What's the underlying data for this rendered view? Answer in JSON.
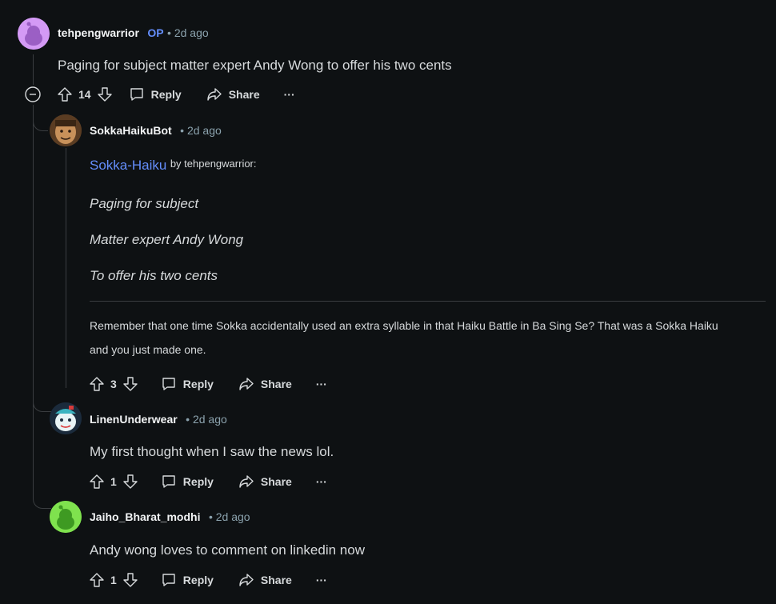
{
  "comments": [
    {
      "username": "tehpengwarrior",
      "op_badge": "OP",
      "time": "• 2d ago",
      "text": "Paging for subject matter expert Andy Wong to offer his two cents",
      "votes": "14",
      "reply": "Reply",
      "share": "Share",
      "more": "···"
    },
    {
      "username": "SokkaHaikuBot",
      "time": "• 2d ago",
      "haiku_link": "Sokka-Haiku",
      "haiku_by": "by tehpengwarrior:",
      "lines": [
        "Paging for subject",
        "Matter expert Andy Wong",
        "To offer his two cents"
      ],
      "footer_line1": "Remember that one time Sokka accidentally used an extra syllable in that Haiku Battle in Ba Sing Se? That was a Sokka Haiku",
      "footer_line2": "and you just made one.",
      "votes": "3",
      "reply": "Reply",
      "share": "Share",
      "more": "···"
    },
    {
      "username": "LinenUnderwear",
      "time": "• 2d ago",
      "text": "My first thought when I saw the news lol.",
      "votes": "1",
      "reply": "Reply",
      "share": "Share",
      "more": "···"
    },
    {
      "username": "Jaiho_Bharat_modhi",
      "time": "• 2d ago",
      "text": "Andy wong loves to comment on linkedin now",
      "votes": "1",
      "reply": "Reply",
      "share": "Share",
      "more": "···"
    }
  ],
  "icons": {
    "collapse": "minus-circle-icon",
    "upvote": "arrow-up-icon",
    "downvote": "arrow-down-icon",
    "reply": "comment-bubble-icon",
    "share": "share-arrow-icon",
    "more": "ellipsis-icon"
  },
  "colors": {
    "background": "#0e1113",
    "op_badge": "#648efc",
    "link": "#648efc",
    "meta": "#8ba2ad"
  }
}
